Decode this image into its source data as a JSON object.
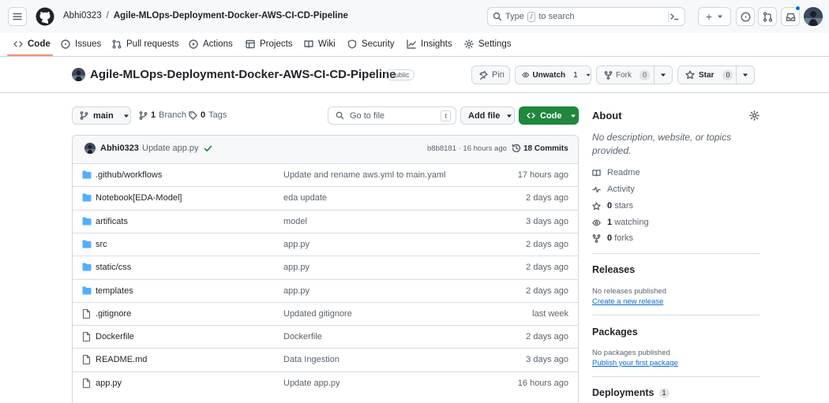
{
  "header": {
    "owner": "Abhi0323",
    "separator": "/",
    "repo": "Agile-MLOps-Deployment-Docker-AWS-CI-CD-Pipeline",
    "search_text_before": "Type",
    "search_key": "/",
    "search_text_after": "to search",
    "plus_label": "+"
  },
  "nav": {
    "tabs": [
      {
        "label": "Code",
        "icon": "code-icon"
      },
      {
        "label": "Issues",
        "icon": "issue-icon"
      },
      {
        "label": "Pull requests",
        "icon": "pull-request-icon"
      },
      {
        "label": "Actions",
        "icon": "play-icon"
      },
      {
        "label": "Projects",
        "icon": "table-icon"
      },
      {
        "label": "Wiki",
        "icon": "book-icon"
      },
      {
        "label": "Security",
        "icon": "shield-icon"
      },
      {
        "label": "Insights",
        "icon": "graph-icon"
      },
      {
        "label": "Settings",
        "icon": "gear-icon"
      }
    ]
  },
  "repo_header": {
    "name": "Agile-MLOps-Deployment-Docker-AWS-CI-CD-Pipeline",
    "visibility": "Public",
    "pin_label": "Pin",
    "unwatch_label": "Unwatch",
    "unwatch_count": "1",
    "fork_label": "Fork",
    "fork_count": "0",
    "star_label": "Star",
    "star_count": "0"
  },
  "toolbar": {
    "branch": "main",
    "branches_count": "1",
    "branches_label": "Branch",
    "tags_count": "0",
    "tags_label": "Tags",
    "goto_placeholder": "Go to file",
    "goto_key": "t",
    "add_file_label": "Add file",
    "code_label": "Code"
  },
  "latest_commit": {
    "author": "Abhi0323",
    "message": "Update app.py",
    "hash_time": "b8b8181 · 16 hours ago",
    "commits_count": "18 Commits"
  },
  "files": [
    {
      "name": ".github/workflows",
      "type": "folder",
      "message": "Update and rename aws.yml to main.yaml",
      "time": "17 hours ago"
    },
    {
      "name": "Notebook[EDA-Model]",
      "type": "folder",
      "message": "eda update",
      "time": "2 days ago"
    },
    {
      "name": "artificats",
      "type": "folder",
      "message": "model",
      "time": "3 days ago"
    },
    {
      "name": "src",
      "type": "folder",
      "message": "app.py",
      "time": "2 days ago"
    },
    {
      "name": "static/css",
      "type": "folder",
      "message": "app.py",
      "time": "2 days ago"
    },
    {
      "name": "templates",
      "type": "folder",
      "message": "app.py",
      "time": "2 days ago"
    },
    {
      "name": ".gitignore",
      "type": "file",
      "message": "Updated gitignore",
      "time": "last week"
    },
    {
      "name": "Dockerfile",
      "type": "file",
      "message": "Dockerfile",
      "time": "2 days ago"
    },
    {
      "name": "README.md",
      "type": "file",
      "message": "Data Ingestion",
      "time": "3 days ago"
    },
    {
      "name": "app.py",
      "type": "file",
      "message": "Update app.py",
      "time": "16 hours ago"
    }
  ],
  "about": {
    "title": "About",
    "description": "No description, website, or topics provided.",
    "readme": "Readme",
    "activity": "Activity",
    "stars_count": "0",
    "stars_label": "stars",
    "watching_count": "1",
    "watching_label": "watching",
    "forks_count": "0",
    "forks_label": "forks"
  },
  "releases": {
    "title": "Releases",
    "empty": "No releases published",
    "link": "Create a new release"
  },
  "packages": {
    "title": "Packages",
    "empty": "No packages published",
    "link": "Publish your first package"
  },
  "deployments": {
    "title": "Deployments",
    "count": "1"
  },
  "colors": {
    "accent_green": "#1f883d",
    "link_blue": "#0969da",
    "folder_blue": "#54aeff",
    "active_tab_underline": "#fd8c73",
    "check_green": "#1a7f37"
  }
}
